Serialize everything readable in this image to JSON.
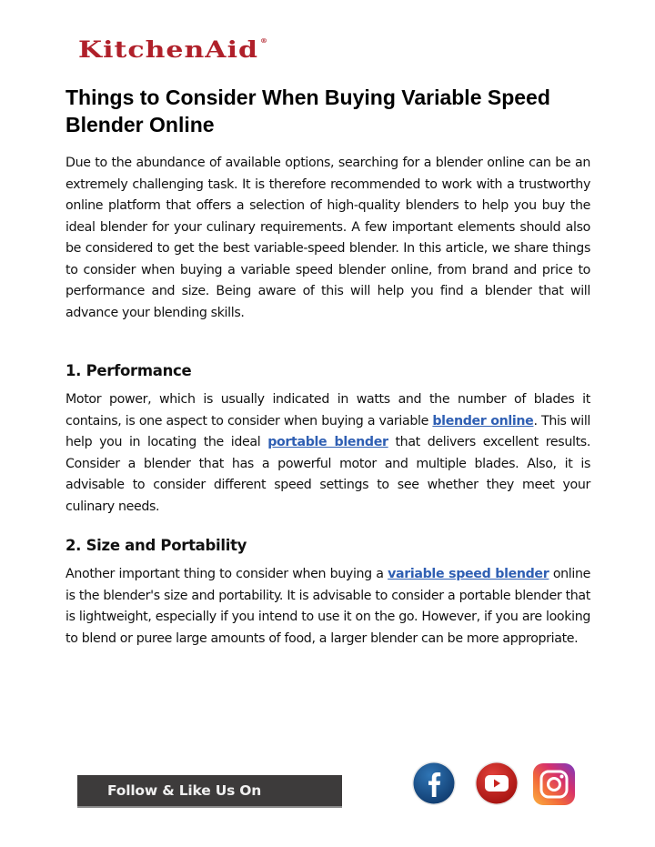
{
  "brand": {
    "logo_text": "KitchenAid",
    "logo_mark": "®",
    "color": "#b0202a"
  },
  "article": {
    "title": "Things to Consider When Buying Variable Speed Blender Online",
    "intro": "Due to the abundance of available options, searching for a blender online can be an extremely challenging task. It is therefore recommended to work with a trustworthy online platform that offers a selection of high-quality blenders to help you buy the ideal blender for your culinary requirements. A few important elements should also be considered to get the best variable-speed blender. In this article, we share things to consider when buying a variable speed blender online, from brand and price to performance and size.  Being aware of this will help you find a blender that will advance your blending skills.",
    "sections": [
      {
        "heading": "1. Performance",
        "text_1": "Motor power, which is usually indicated in watts and the number of blades it contains, is one aspect to consider when buying a variable ",
        "link_1": "blender online",
        "text_2": ". This will help you in locating the ideal ",
        "link_2": "portable blender",
        "text_3": " that delivers excellent results. Consider a blender that has a powerful motor and multiple blades. Also, it is advisable to consider different speed settings to see whether they meet your culinary needs."
      },
      {
        "heading": "2. Size and Portability",
        "text_1": "Another important thing to consider when buying a ",
        "link_1": "variable speed blender",
        "text_2": " online is the blender's size and portability. It is advisable to consider a portable blender that is lightweight, especially if you intend to use it on the go. However, if you are looking to blend or puree large amounts of food, a larger blender can be more appropriate."
      }
    ],
    "link_color": "#2f5fb3"
  },
  "footer": {
    "follow_label": "Follow & Like Us On",
    "social": [
      {
        "name": "facebook",
        "icon": "facebook-icon",
        "color": "#1d5a95"
      },
      {
        "name": "youtube",
        "icon": "youtube-icon",
        "color": "#c8231f"
      },
      {
        "name": "instagram",
        "icon": "instagram-icon",
        "color": "#d6306b"
      }
    ]
  }
}
